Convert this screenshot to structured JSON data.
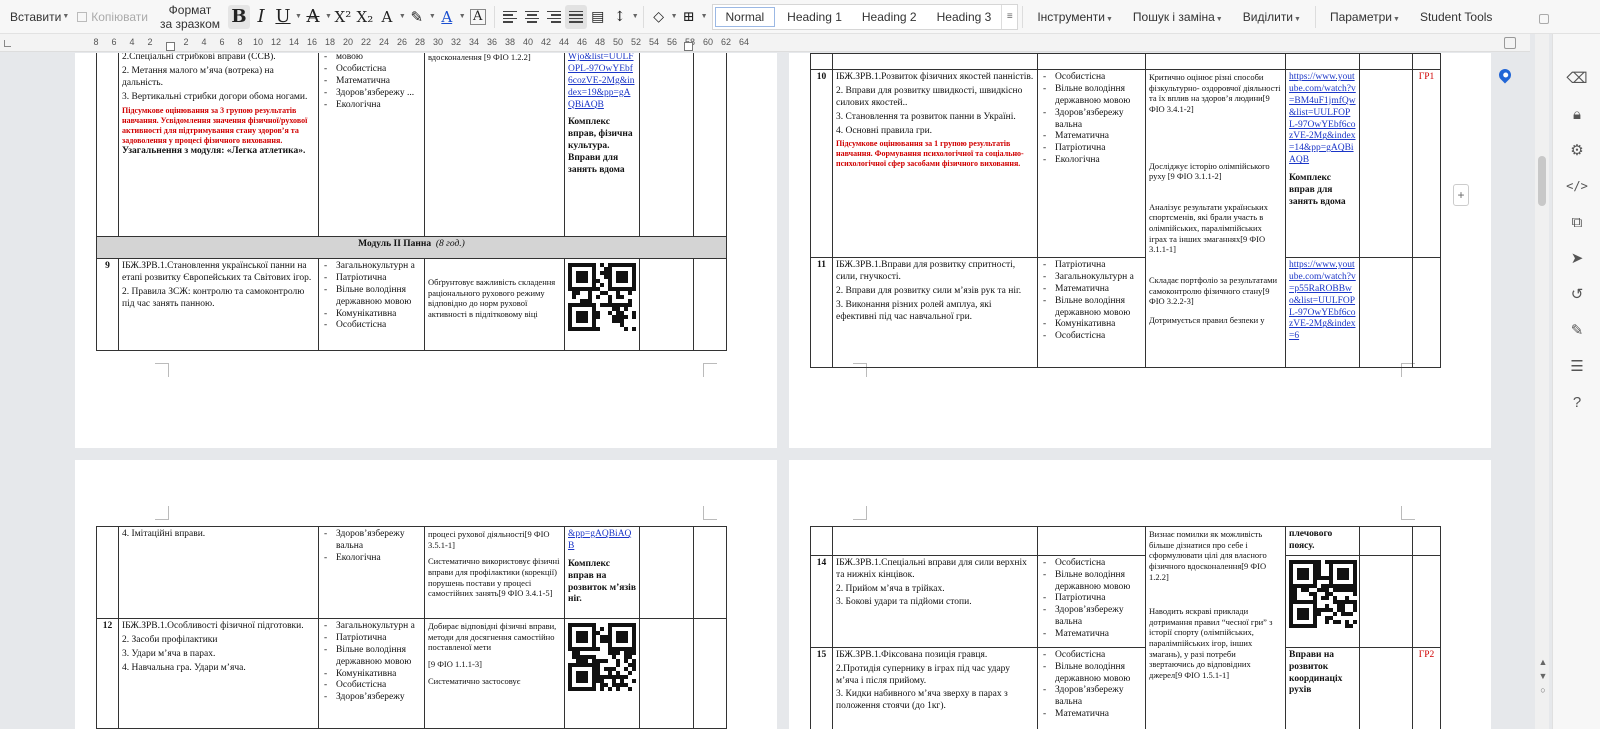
{
  "toolbar": {
    "paste": "Вставити",
    "copy": "Копіювати",
    "format_line1": "Формат",
    "format_line2": "за зразком",
    "styles": [
      "Normal",
      "Heading 1",
      "Heading 2",
      "Heading 3"
    ],
    "menus": [
      "Інструменти",
      "Пошук і заміна",
      "Виділити",
      "Параметри",
      "Student Tools"
    ]
  },
  "ruler": {
    "numbers": [
      "8",
      "6",
      "4",
      "2",
      "2",
      "4",
      "6",
      "8",
      "10",
      "12",
      "14",
      "16",
      "18",
      "20",
      "22",
      "24",
      "26",
      "28",
      "30",
      "32",
      "34",
      "36",
      "38",
      "40",
      "42",
      "44",
      "46",
      "48",
      "50",
      "52",
      "54",
      "56",
      "58",
      "60",
      "62",
      "64"
    ]
  },
  "page1": {
    "row_top": {
      "content": [
        "2.Спеціальні стрибкові вправи (ССВ).",
        "2.  Метання малого м’яча (вотрека) на дальність.",
        "3.  Вертикальні стрибки догори обома ногами."
      ],
      "red": "Підсумкове оцінювання за 3 групою результатів навчання. Усвідомлення значення фізичної/рухової активності для підтримування стану здоров’я та задоволення у процесі фізичного виховання.",
      "summary": "Узагальнення з модуля: «Легка атлетика».",
      "lines": [
        "мовою",
        "Особистісна",
        "Математична",
        "Здоров’язбережу ...",
        "Екологічна"
      ],
      "outcome": "вдосконалення [9 ФІО 1.2.2]",
      "link": "Wjo&list=UULFOPL-97OwYEbf6cozVE-2Mg&index=19&pp=gAQBiAQB",
      "resource": "Комплекс вправ, фізична культура. Вправи для занять вдома"
    },
    "module": "Модуль II Панна",
    "module_hours": "(8 год.)",
    "row9": {
      "num": "9",
      "content": [
        "ІБЖ.ЗРВ.1.Становлення української панни на етапі  розвитку  Європейських   та Світових ігор.",
        "2.  Правила ЗСЖ: контролю та самоконтролю під час занять панною."
      ],
      "lines": [
        "Загальнокультурн а",
        "Патріотична",
        "Вільне володіння державною мовою",
        "Комунікативна",
        "Особистісна"
      ],
      "outcome": "Обґрунтовує важливість складення раціонального рухового режиму відповідно до норм рухової активності в підлітковому віці"
    }
  },
  "page2": {
    "row10": {
      "num": "10",
      "content": [
        "ІБЖ.ЗРВ.1.Розвиток фізичних якостей панністів.",
        "2.  Вправи для розвитку швидкості, швидкісно силових якостей..",
        "3.  Становлення та розвиток панни в Україні.",
        "4.  Основні правила гри."
      ],
      "red": "Підсумкове оцінювання за 1 групою результатів навчання. Формування психологічної та соціально-психологічної сфер засобами фізичного виховання.",
      "lines": [
        "Особистісна",
        "Вільне володіння державною мовою",
        "Здоров’язбережу вальна",
        "Математична",
        "Патріотична",
        "Екологічна"
      ],
      "outcomes": [
        "Критично оцінює різні способи фізкультурно- оздоровчої діяльності та їх вплив на здоров’я людини[9 ФІО 3.4.1-2]",
        "Досліджує історію олімпійського руху [9 ФІО 3.1.1-2]",
        "Аналізує результати українських спортсменів, які брали участь в  олімпійських, паралімпійських іграх та інших змаганнях[9 ФІО 3.1.1-1]"
      ],
      "link": "https://www.youtube.com/watch?v=BM4uF1jmfQw&list=UULFOPL-97OwYEbf6cozVE-2Mg&index=14&pp=gAQBiAQB",
      "resource": "Комплекс вправ для занять вдома",
      "gp": "ГР1"
    },
    "row11": {
      "num": "11",
      "content": [
        "ІБЖ.ЗРВ.1.Вправи для розвитку спритності, сили, гнучкості.",
        "2.  Вправи для розвитку сили м’язів рук та ніг.",
        "3.  Виконання різних ролей амплуа, які ефективні під час навчальної гри."
      ],
      "lines": [
        "Патріотична",
        "Загальнокультурн а",
        "Математична",
        "Вільне володіння державною мовою",
        "Комунікативна",
        "Особистісна"
      ],
      "outcomes": [
        "Складає портфоліо за результатами самоконтролю фізичного стану[9 ФІО 3.2.2-3]",
        "Дотримується правил безпеки у"
      ],
      "link": "https://www.youtube.com/watch?v=p55RaROBBwo&list=UULFOPL-97OwYEbf6cozVE-2Mg&index=6"
    }
  },
  "page3": {
    "row_top": {
      "content": "4.  Імітаційні вправи.",
      "lines": [
        "Здоров’язбережу вальна",
        "Екологічна"
      ],
      "outcomes": [
        "процесі рухової діяльності[9 ФІО 3.5.1-1]",
        "Систематично використовує фізичні вправи для профілактики (корекції) порушень постави у процесі самостійних занять[9 ФІО 3.4.1-5]"
      ],
      "link": "&pp=gAQBiAQB",
      "resource": "Комплекс вправ на розвиток м’язів ніг."
    },
    "row12": {
      "num": "12",
      "content": [
        "ІБЖ.ЗРВ.1.Особливості фізичної підготовки.",
        "2. Засоби  профілактики",
        "3. Удари м’яча в парах.",
        "4. Навчальна гра. Удари м’яча."
      ],
      "lines": [
        "Загальнокультурн а",
        "Патріотична",
        "Вільне володіння державною мовою",
        "Комунікативна",
        "Особистісна",
        "Здоров’язбережу"
      ],
      "outcomes": [
        "Добирає відповідні фізичні вправи, методи для досягнення самостійно поставленої мети",
        "[9 ФІО 1.1.1-3]",
        "Систематично застосовує"
      ]
    }
  },
  "page4": {
    "row_top": {
      "outcome": "Визнає помилки як можливість більше дізнатися про себе і сформулювати цілі для власного фізичного вдосконалення[9 ФІО 1.2.2]",
      "resource": "плечового поясу."
    },
    "row14": {
      "num": "14",
      "content": [
        "ІБЖ.ЗРВ.1.Спеціальні вправи  для сили верхніх та нижніх кінцівок.",
        "2.  Прийом м’яча в трійках.",
        "3.  Бокові удари та підйоми стопи."
      ],
      "lines": [
        "Особистісна",
        "Вільне володіння державною мовою",
        "Патріотична",
        "Здоров’язбережу вальна",
        "Математична"
      ],
      "outcome": "Наводить яскраві приклади дотримання правил “чесної гри” з історії спорту (олімпійських, паралімпійських ігор, інших змагань), у разі потреби звертаючись до відповідних джерел[9 ФІО 1.5.1-1]"
    },
    "row15": {
      "num": "15",
      "content": [
        "ІБЖ.ЗРВ.1.Фіксована позиція гравця.",
        "2.Протидія супернику в іграх під час удару м’яча і після прийому.",
        "3. Кидки набивного м’яча зверху в парах з положення стоячи (до 1кг)."
      ],
      "lines": [
        "Особистісна",
        "Вільне володіння державною мовою",
        "Здоров’язбережу вальна",
        "Математична"
      ],
      "resource": "Вправи на розвиток координаціх рухів",
      "gp": "ГР2"
    }
  },
  "sidebar_icons": [
    "eraser-icon",
    "lock-icon",
    "sliders-icon",
    "code-icon",
    "copy-icon",
    "cursor-icon",
    "history-icon",
    "pen-icon",
    "list-icon",
    "help-icon"
  ],
  "colors": {
    "accent": "#2266d6",
    "red": "#d00000",
    "link": "#1a35c7",
    "module_bg": "#d4d4d4"
  }
}
